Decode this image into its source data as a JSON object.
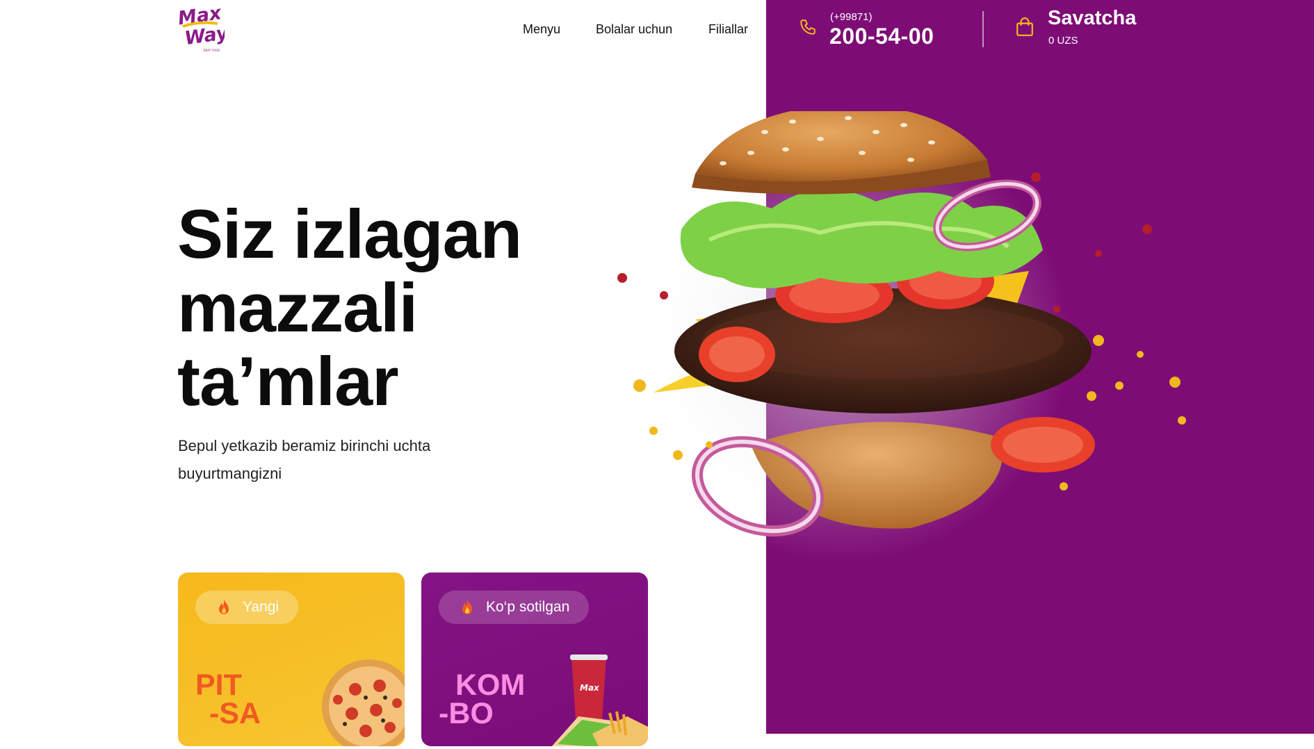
{
  "header": {
    "logo_text_line1": "Max",
    "logo_text_line2": "Way",
    "logo_tagline": "BRAT FOOD",
    "nav": [
      {
        "label": "Menyu"
      },
      {
        "label": "Bolalar uchun"
      },
      {
        "label": "Filiallar"
      }
    ],
    "phone": {
      "prefix": "(+99871)",
      "number": "200-54-00",
      "icon": "phone-icon"
    },
    "cart": {
      "title": "Savatcha",
      "total": "0 UZS",
      "icon": "shopping-bag-icon"
    }
  },
  "hero": {
    "title_lines": [
      "Siz izlagan",
      "mazzali",
      "ta’mlar"
    ],
    "subtitle": "Bepul yetkazib beramiz birinchi uchta buyurtmangizni",
    "image": "burger-illustration"
  },
  "cards": [
    {
      "badge": "Yangi",
      "word_line1": "PIT",
      "word_line2": "-SA",
      "image": "pizza-illustration"
    },
    {
      "badge": "Ko‘p sotilgan",
      "word_line1": "KOM",
      "word_line2": "-BO",
      "image": "combo-illustration"
    }
  ],
  "colors": {
    "brand_purple": "#7d0c75",
    "accent_yellow": "#f6b91b",
    "accent_orange": "#f05a22",
    "pink": "#ff8be3"
  }
}
